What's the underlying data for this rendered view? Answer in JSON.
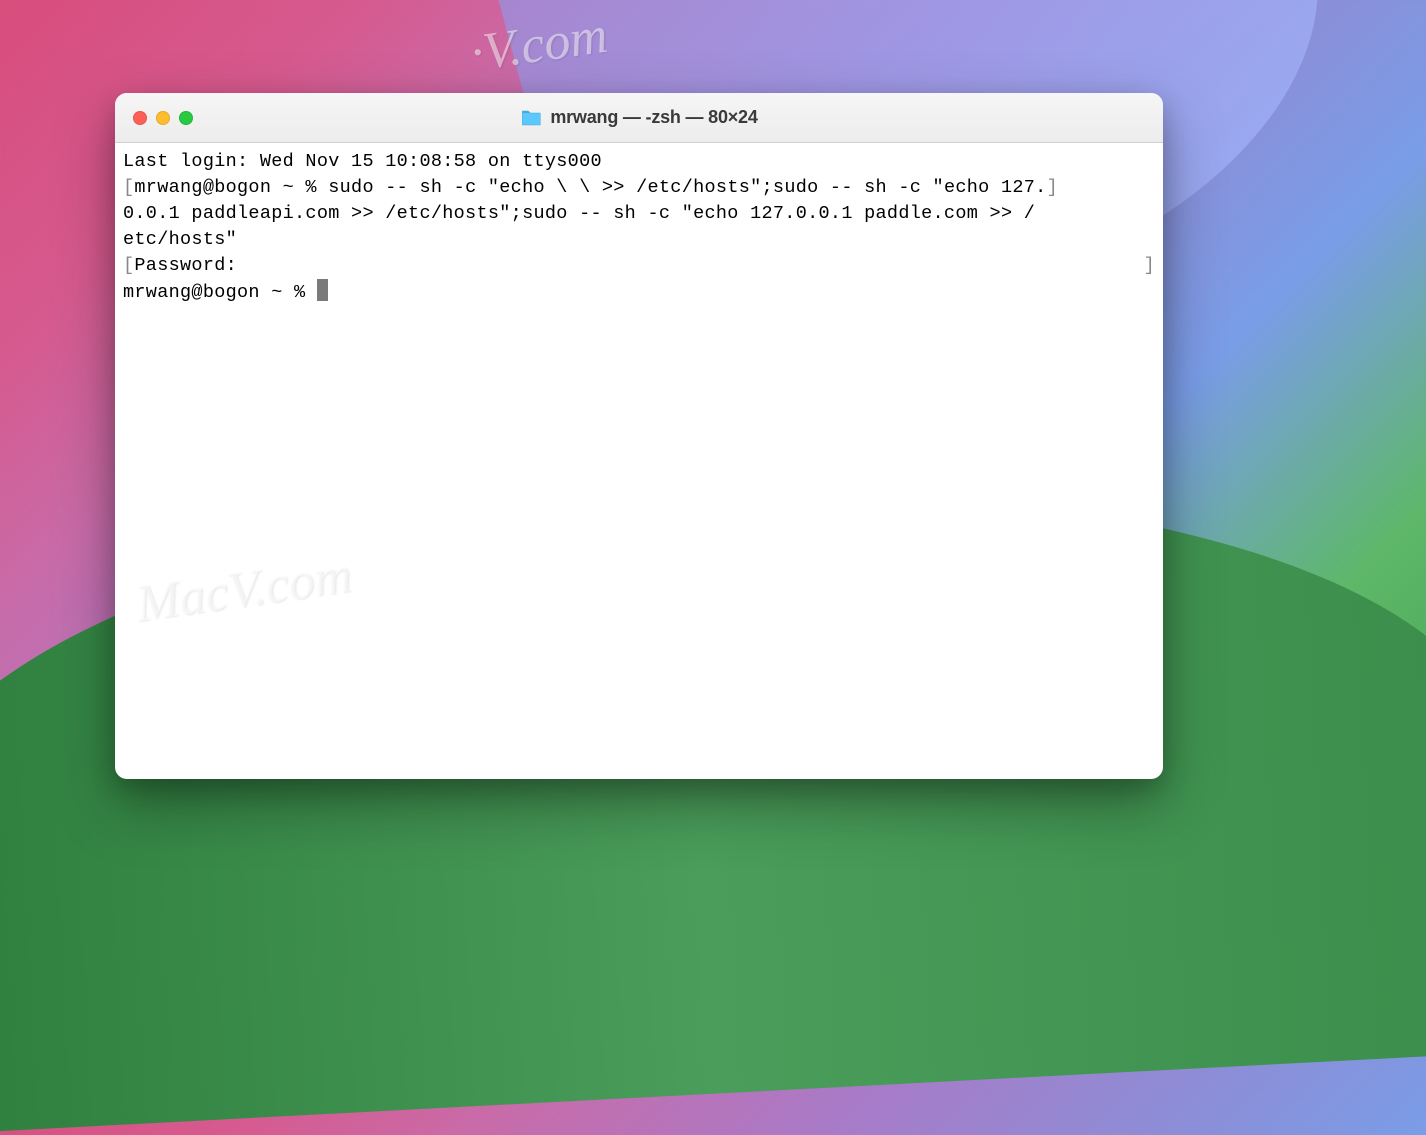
{
  "watermarks": {
    "top": "·V.com",
    "bottom": "MacV.com"
  },
  "window": {
    "title": "mrwang — -zsh — 80×24"
  },
  "terminal": {
    "lines": {
      "last_login": "Last login: Wed Nov 15 10:08:58 on ttys000",
      "prompt1_bracket_open": "[",
      "prompt1_host": "mrwang@bogon ~ % ",
      "command": "sudo -- sh -c \"echo \\ \\ >> /etc/hosts\";sudo -- sh -c \"echo 127.",
      "prompt1_bracket_close": "]",
      "command_cont1": "0.0.1 paddleapi.com >> /etc/hosts\";sudo -- sh -c \"echo 127.0.0.1 paddle.com >> /",
      "command_cont2": "etc/hosts\"",
      "password_bracket_open": "[",
      "password_label": "Password:",
      "password_bracket_close": "]",
      "prompt2": "mrwang@bogon ~ % "
    }
  }
}
